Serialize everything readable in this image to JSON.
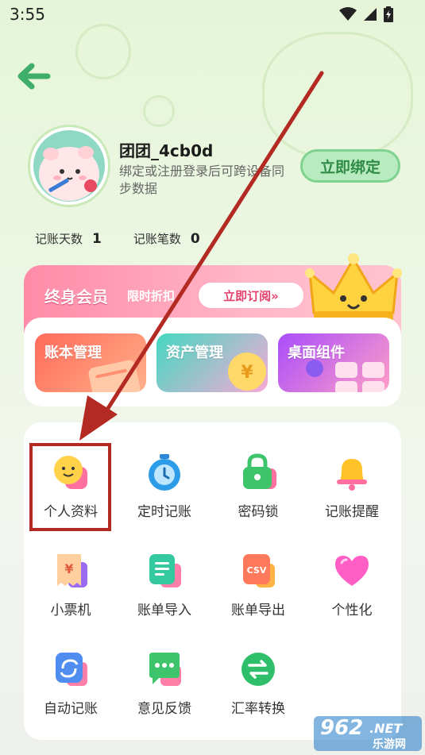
{
  "status_bar": {
    "time": "3:55"
  },
  "profile": {
    "username": "团团_4cb0d",
    "bind_hint": "绑定或注册登录后可跨设备同步数据",
    "bind_button": "立即绑定"
  },
  "stats": [
    {
      "label": "记账天数",
      "value": "1"
    },
    {
      "label": "记账笔数",
      "value": "0"
    }
  ],
  "vip": {
    "title": "终身会员",
    "subtitle": "限时折扣",
    "subscribe_button": "立即订阅»"
  },
  "features": [
    {
      "label": "账本管理"
    },
    {
      "label": "资产管理"
    },
    {
      "label": "桌面组件"
    }
  ],
  "grid": [
    {
      "label": "个人资料"
    },
    {
      "label": "定时记账"
    },
    {
      "label": "密码锁"
    },
    {
      "label": "记账提醒"
    },
    {
      "label": "小票机"
    },
    {
      "label": "账单导入"
    },
    {
      "label": "账单导出"
    },
    {
      "label": "个性化"
    },
    {
      "label": "自动记账"
    },
    {
      "label": "意见反馈"
    },
    {
      "label": "汇率转换"
    }
  ],
  "icon_glyphs": {
    "receipt": "¥",
    "asset": "¥",
    "export": "CSV"
  },
  "watermark": {
    "number": "962",
    "suffix": ".NET",
    "name": "乐游网"
  },
  "colors": {
    "accent_green": "#2f8a45",
    "vip_pink": "#ff8aa8",
    "highlight_red": "#b22a22"
  }
}
